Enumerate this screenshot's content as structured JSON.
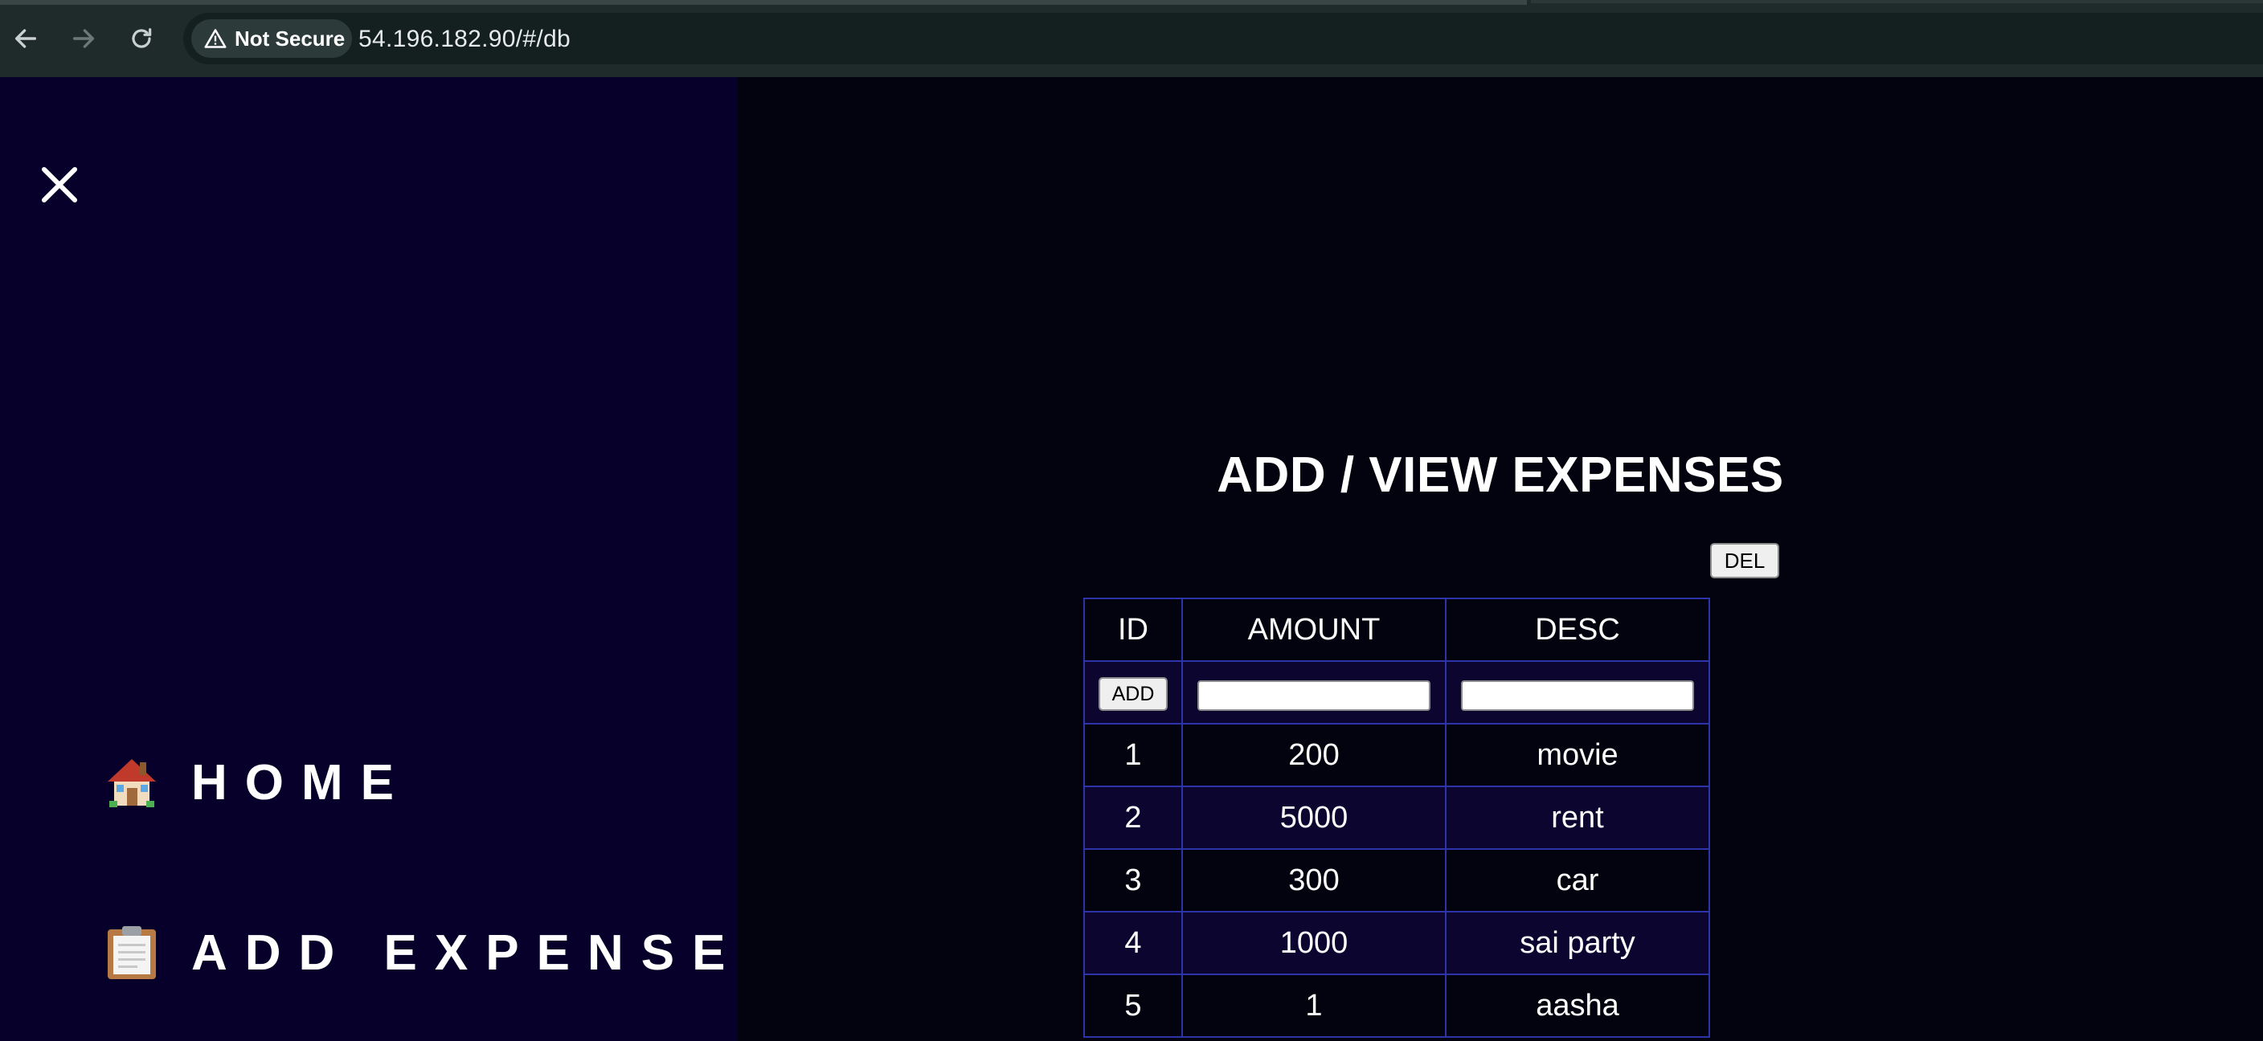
{
  "browser": {
    "security_label": "Not Secure",
    "url": "54.196.182.90/#/db"
  },
  "sidebar": {
    "items": [
      {
        "emoji": "house-icon",
        "label": "HOME"
      },
      {
        "emoji": "clipboard-icon",
        "label": "ADD EXPENSE"
      }
    ]
  },
  "main": {
    "title": "ADD / VIEW EXPENSES",
    "del_label": "DEL",
    "add_label": "ADD",
    "amount_input": {
      "value": "",
      "placeholder": ""
    },
    "desc_input": {
      "value": "",
      "placeholder": ""
    },
    "table": {
      "headers": [
        "ID",
        "AMOUNT",
        "DESC"
      ],
      "rows": [
        [
          "1",
          "200",
          "movie"
        ],
        [
          "2",
          "5000",
          "rent"
        ],
        [
          "3",
          "300",
          "car"
        ],
        [
          "4",
          "1000",
          "sai party"
        ],
        [
          "5",
          "1",
          "aasha"
        ]
      ]
    }
  },
  "colors": {
    "sidebar_bg": "#07002a",
    "main_bg": "#03020f",
    "table_border": "#2c34a8",
    "row_alt_bg": "#0c0530"
  }
}
